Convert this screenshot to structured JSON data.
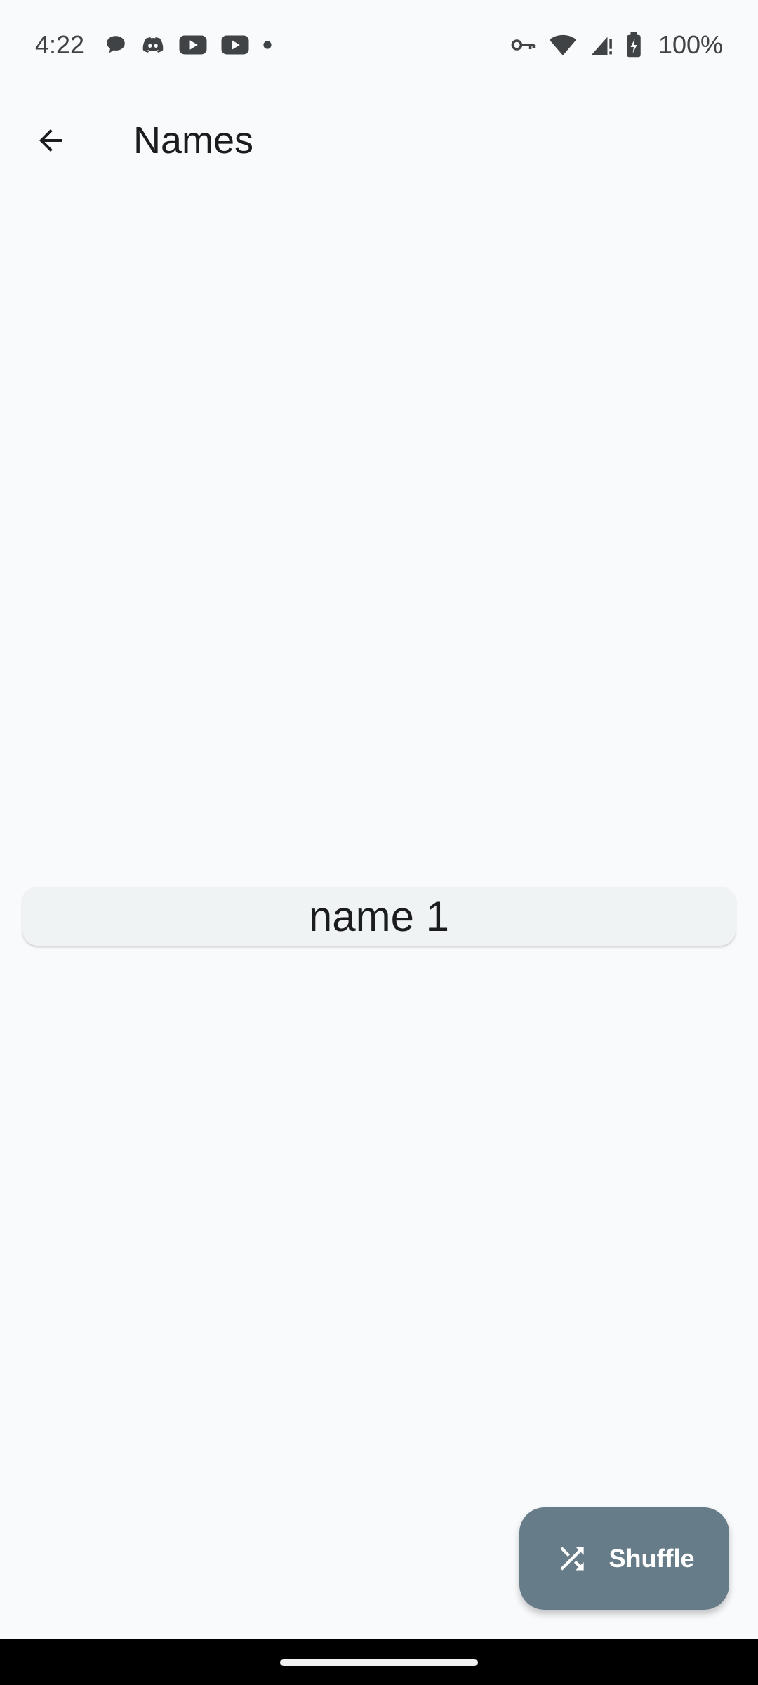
{
  "status_bar": {
    "time": "4:22",
    "battery": "100%",
    "notification_icons": [
      "chat-bubble-icon",
      "discord-icon",
      "youtube-icon",
      "youtube-icon",
      "dot-icon"
    ],
    "system_icons": [
      "vpn-key-icon",
      "wifi-icon",
      "cellular-signal-icon",
      "battery-charging-icon"
    ]
  },
  "app_bar": {
    "back_icon": "arrow-back-icon",
    "title": "Names"
  },
  "list": {
    "items": [
      "name 1"
    ]
  },
  "fab": {
    "icon": "shuffle-icon",
    "label": "Shuffle"
  },
  "colors": {
    "background": "#f9fafc",
    "card": "#eff3f4",
    "fab": "#667c89",
    "fab_text": "#ffffff",
    "nav_bar": "#000000"
  }
}
